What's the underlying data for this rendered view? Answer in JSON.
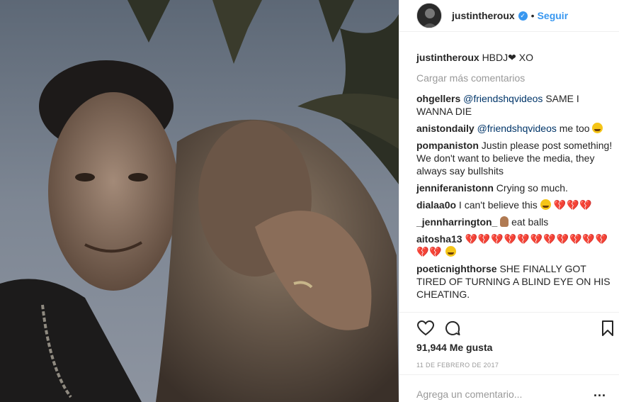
{
  "post": {
    "author": "justintheroux",
    "follow_label": "Seguir",
    "dot": "•",
    "verified_mark": "✓",
    "photo_icon": "photo"
  },
  "caption": {
    "user": "justintheroux",
    "text": "HBDJ❤ XO"
  },
  "load_more_label": "Cargar más comentarios",
  "comments": [
    {
      "user": "ohgellers",
      "mention": "@friendshqvideos",
      "text": "SAME I WANNA DIE"
    },
    {
      "user": "anistondaily",
      "mention": "@friendshqvideos",
      "text": "me too"
    },
    {
      "user": "pompaniston",
      "text": "Justin please post something! We don't want to believe the media, they always say bullshits"
    },
    {
      "user": "jenniferanistonn",
      "text": "Crying so much."
    },
    {
      "user": "dialaa0o",
      "text": "I can't believe this"
    },
    {
      "user": "_jennharrington_",
      "text": "eat balls"
    },
    {
      "user": "aitosha13",
      "text": ""
    },
    {
      "user": "poeticnighthorse",
      "text": "SHE FINALLY GOT TIRED OF TURNING A BLIND EYE ON HIS CHEATING."
    }
  ],
  "emoji": {
    "broken_hearts_3": "💔💔💔",
    "broken_hearts_12": "💔💔💔💔💔💔💔💔💔💔💔💔💔"
  },
  "icons": {
    "like": "heart-icon",
    "comment": "comment-icon",
    "save": "bookmark-icon",
    "more": "more-options-icon"
  },
  "likes_text": "91,944 Me gusta",
  "date_text": "11 DE FEBRERO DE 2017",
  "add_comment_placeholder": "Agrega un comentario...",
  "more_label": "..."
}
